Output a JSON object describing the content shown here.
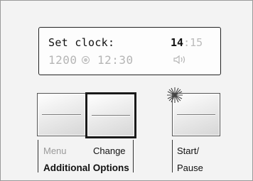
{
  "display": {
    "title": "Set clock:",
    "clock_hour": "14",
    "clock_sep": ":",
    "clock_minute": "15",
    "spin_speed": "1200",
    "end_time": "12:30",
    "icons": {
      "spin": "spin-speed-icon",
      "sound": "speaker-icon"
    }
  },
  "buttons": {
    "menu_label": "Menu",
    "change_label": "Change",
    "group_label": "Additional Options",
    "start_label_line1": "Start/",
    "start_label_line2": "Pause"
  },
  "state": {
    "change_highlighted": true,
    "start_flashing": true
  }
}
